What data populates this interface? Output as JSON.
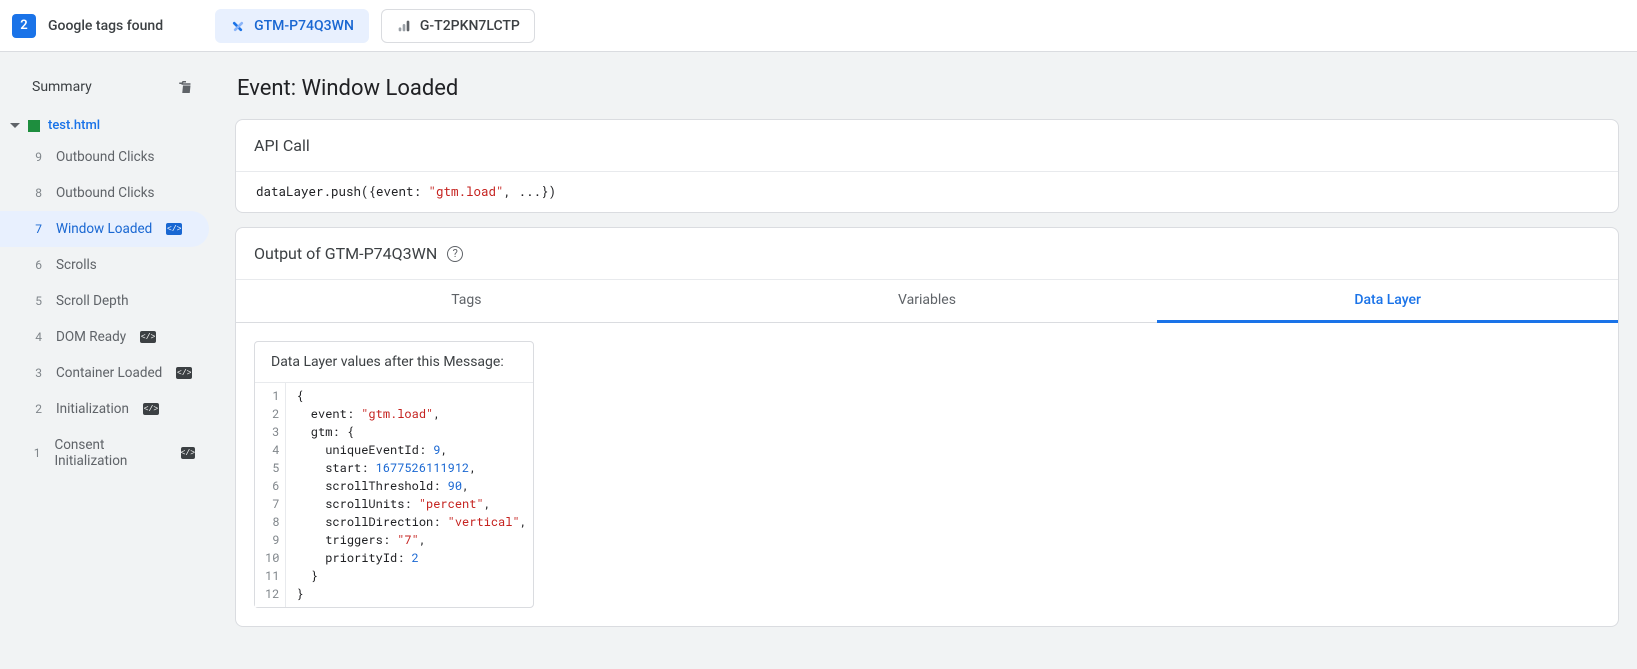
{
  "topbar": {
    "count": "2",
    "title": "Google tags found",
    "tags": [
      {
        "label": "GTM-P74Q3WN",
        "active": true,
        "kind": "gtm"
      },
      {
        "label": "G-T2PKN7LCTP",
        "active": false,
        "kind": "ga"
      }
    ]
  },
  "sidebar": {
    "summary_label": "Summary",
    "file_label": "test.html",
    "events": [
      {
        "n": "9",
        "label": "Outbound Clicks",
        "chip": false,
        "active": false
      },
      {
        "n": "8",
        "label": "Outbound Clicks",
        "chip": false,
        "active": false
      },
      {
        "n": "7",
        "label": "Window Loaded",
        "chip": true,
        "active": true
      },
      {
        "n": "6",
        "label": "Scrolls",
        "chip": false,
        "active": false
      },
      {
        "n": "5",
        "label": "Scroll Depth",
        "chip": false,
        "active": false
      },
      {
        "n": "4",
        "label": "DOM Ready",
        "chip": true,
        "active": false
      },
      {
        "n": "3",
        "label": "Container Loaded",
        "chip": true,
        "active": false
      },
      {
        "n": "2",
        "label": "Initialization",
        "chip": true,
        "active": false
      },
      {
        "n": "1",
        "label": "Consent Initialization",
        "chip": true,
        "active": false
      }
    ]
  },
  "page": {
    "title": "Event: Window Loaded"
  },
  "api_card": {
    "header": "API Call",
    "call_prefix": "dataLayer.push({event: ",
    "call_string": "\"gtm.load\"",
    "call_suffix": ", ...})"
  },
  "output_card": {
    "header": "Output of GTM-P74Q3WN",
    "tabs": [
      {
        "label": "Tags",
        "active": false
      },
      {
        "label": "Variables",
        "active": false
      },
      {
        "label": "Data Layer",
        "active": true
      }
    ],
    "dl_title": "Data Layer values after this Message:",
    "dl": {
      "event": "gtm.load",
      "uniqueEventId": 9,
      "start": 1677526111912,
      "scrollThreshold": 90,
      "scrollUnits": "percent",
      "scrollDirection": "vertical",
      "triggers": "7",
      "priorityId": 2
    }
  }
}
